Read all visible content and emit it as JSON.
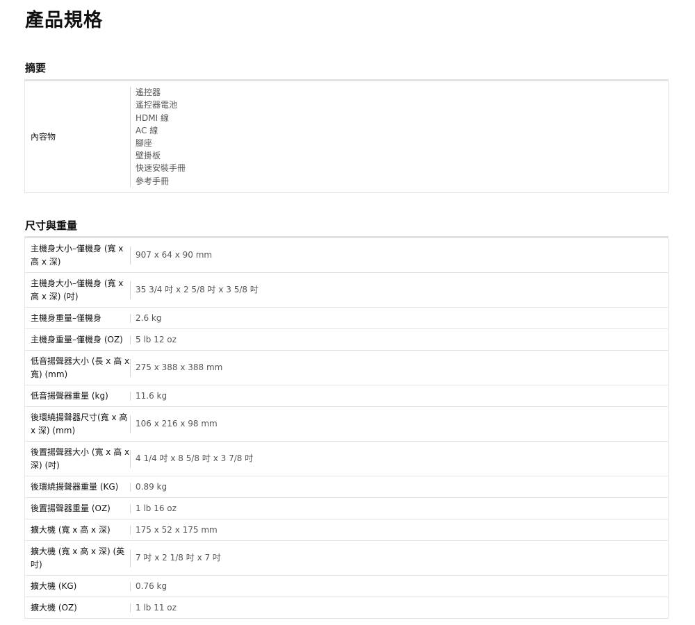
{
  "page": {
    "title": "產品規格"
  },
  "summary": {
    "heading": "摘要",
    "contents_label": "內容物",
    "contents_items": [
      "遙控器",
      "遙控器電池",
      "HDMI 線",
      "AC 線",
      "腳座",
      "壁掛板",
      "快速安裝手冊",
      "參考手冊"
    ]
  },
  "dimensions": {
    "heading": "尺寸與重量",
    "rows": [
      {
        "label": "主機身大小–僅機身 (寬 x 高 x 深)",
        "value": "907 x 64 x 90 mm"
      },
      {
        "label": "主機身大小–僅機身 (寬 x 高 x 深) (吋)",
        "value": "35 3/4 吋 x 2 5/8 吋 x 3 5/8 吋"
      },
      {
        "label": "主機身重量–僅機身",
        "value": "2.6 kg"
      },
      {
        "label": "主機身重量–僅機身 (OZ)",
        "value": "5 lb 12 oz"
      },
      {
        "label": "低音揚聲器大小 (長 x 高 x 寬) (mm)",
        "value": "275 x 388 x 388 mm"
      },
      {
        "label": "低音揚聲器重量 (kg)",
        "value": "11.6 kg"
      },
      {
        "label": "後環繞揚聲器尺寸(寬 x 高 x 深) (mm)",
        "value": "106 x 216 x 98 mm"
      },
      {
        "label": "後置揚聲器大小 (寬 x 高 x 深) (吋)",
        "value": "4 1/4 吋 x 8 5/8 吋 x 3 7/8 吋"
      },
      {
        "label": "後環繞揚聲器重量 (KG)",
        "value": "0.89 kg"
      },
      {
        "label": "後置揚聲器重量 (OZ)",
        "value": "1 lb 16 oz"
      },
      {
        "label": "擴大機 (寬 x 高 x 深)",
        "value": "175 x 52 x 175 mm"
      },
      {
        "label": "擴大機 (寬 x 高 x 深) (英吋)",
        "value": "7 吋 x 2 1/8 吋 x 7 吋"
      },
      {
        "label": "擴大機 (KG)",
        "value": "0.76 kg"
      },
      {
        "label": "擴大機 (OZ)",
        "value": "1 lb 11 oz"
      }
    ]
  }
}
